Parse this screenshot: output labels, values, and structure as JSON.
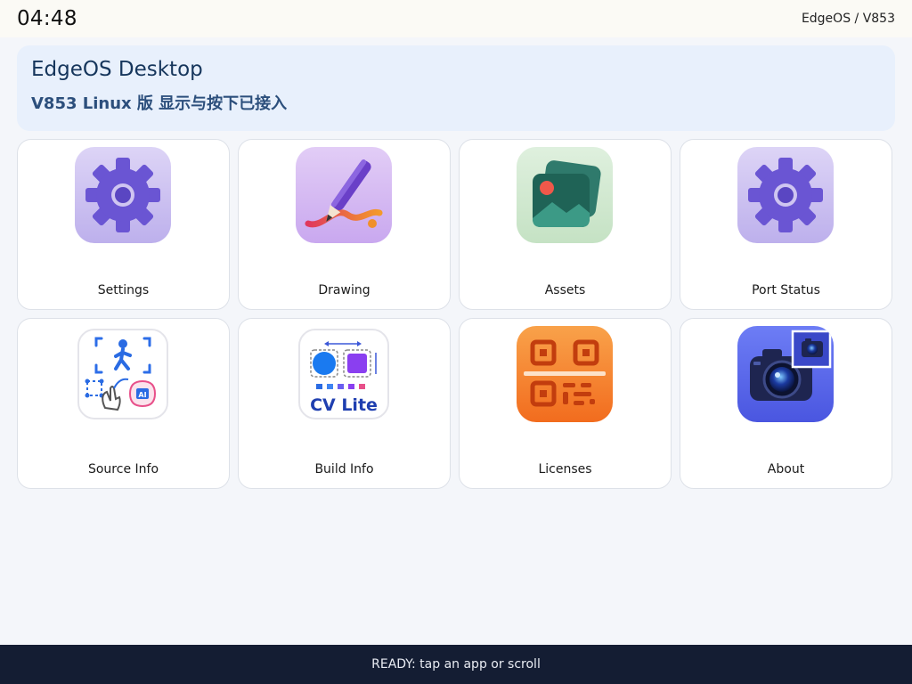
{
  "topbar": {
    "clock": "04:48",
    "system": "EdgeOS / V853"
  },
  "banner": {
    "title": "EdgeOS Desktop",
    "subtitle": "V853 Linux 版  显示与按下已接入"
  },
  "apps": [
    {
      "label": "Settings",
      "icon": "gear-icon"
    },
    {
      "label": "Drawing",
      "icon": "pen-icon"
    },
    {
      "label": "Assets",
      "icon": "image-gallery-icon"
    },
    {
      "label": "Port Status",
      "icon": "gear-icon"
    },
    {
      "label": "Source Info",
      "icon": "ai-vision-icon"
    },
    {
      "label": "Build Info",
      "icon": "cv-lite-icon",
      "icon_text": "CV Lite"
    },
    {
      "label": "Licenses",
      "icon": "qr-code-icon"
    },
    {
      "label": "About",
      "icon": "camera-icon"
    }
  ],
  "footer": {
    "status": "READY: tap an app or scroll"
  },
  "colors": {
    "background": "#f4f6fa",
    "banner": "#e8f0fc",
    "footer": "#141d33",
    "accent_purple": "#6b55d6",
    "accent_orange": "#f06a1e"
  }
}
